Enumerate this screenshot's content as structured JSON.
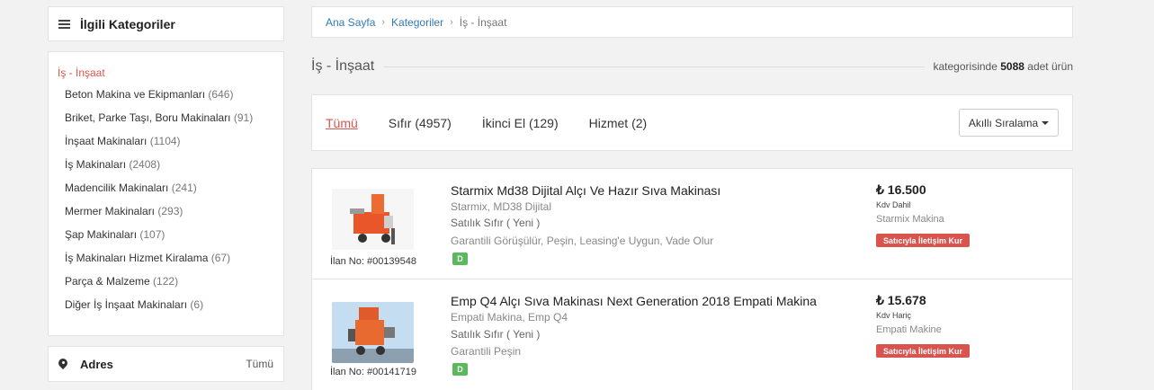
{
  "sidebar": {
    "title": "İlgili Kategoriler",
    "active_category": "İş - İnşaat",
    "categories": [
      {
        "label": "Beton Makina ve Ekipmanları",
        "count": "(646)"
      },
      {
        "label": "Briket, Parke Taşı, Boru Makinaları",
        "count": "(91)"
      },
      {
        "label": "İnşaat Makinaları",
        "count": "(1104)"
      },
      {
        "label": "İş Makinaları",
        "count": "(2408)"
      },
      {
        "label": "Madencilik Makinaları",
        "count": "(241)"
      },
      {
        "label": "Mermer Makinaları",
        "count": "(293)"
      },
      {
        "label": "Şap Makinaları",
        "count": "(107)"
      },
      {
        "label": "İş Makinaları Hizmet Kiralama",
        "count": "(67)"
      },
      {
        "label": "Parça & Malzeme",
        "count": "(122)"
      },
      {
        "label": "Diğer İş İnşaat Makinaları",
        "count": "(6)"
      }
    ],
    "address": {
      "title": "Adres",
      "all_link": "Tümü"
    }
  },
  "breadcrumb": {
    "home": "Ana Sayfa",
    "categories": "Kategoriler",
    "current": "İş - İnşaat"
  },
  "header": {
    "title": "İş - İnşaat",
    "count_prefix": "kategorisinde",
    "count": "5088",
    "count_suffix": "adet ürün"
  },
  "tabs": [
    "Tümü",
    "Sıfır (4957)",
    "İkinci El (129)",
    "Hizmet (2)"
  ],
  "sort_label": "Akıllı Sıralama",
  "colors": {
    "accent_red": "#d9534f",
    "link_blue": "#337ab7",
    "badge_green": "#5cb85c"
  },
  "listings": [
    {
      "title": "Starmix Md38 Dijital Alçı Ve Hazır Sıva Makinası",
      "brand_model": "Starmix, MD38 Dijital",
      "condition": "Satılık Sıfır ( Yeni )",
      "features": "Garantili Görüşülür, Peşin, Leasing'e Uygun, Vade Olur",
      "ad_no": "İlan No: #00139548",
      "badge": "D",
      "price": "₺ 16.500",
      "tax": "Kdv Dahil",
      "seller": "Starmix Makina",
      "contact": "Satıcıyla İletişim Kur"
    },
    {
      "title": "Emp Q4 Alçı Sıva Makinası Next Generation 2018 Empati Makina",
      "brand_model": "Empati Makina, Emp Q4",
      "condition": "Satılık Sıfır ( Yeni )",
      "features": "Garantili Peşin",
      "ad_no": "İlan No: #00141719",
      "badge": "D",
      "price": "₺ 15.678",
      "tax": "Kdv Hariç",
      "seller": "Empati Makine",
      "contact": "Satıcıyla İletişim Kur"
    }
  ]
}
